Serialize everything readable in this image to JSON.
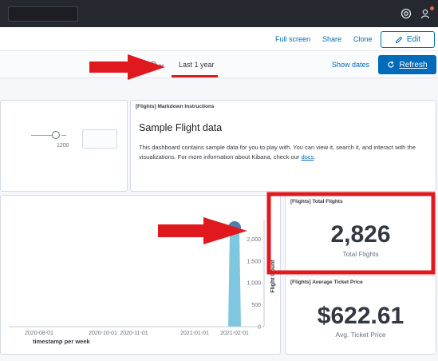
{
  "header": {
    "help_icon": "help-icon",
    "user_icon": "user-menu-icon"
  },
  "actions": {
    "full_screen": "Full screen",
    "share": "Share",
    "clone": "Clone",
    "edit": "Edit",
    "edit_icon": "pencil-icon"
  },
  "query": {
    "time_range": "Last 1 year",
    "show_dates": "Show dates",
    "refresh": "Refresh",
    "refresh_icon": "refresh-icon",
    "calendar_icon": "calendar-icon"
  },
  "controls": {
    "slider_max": "1200"
  },
  "markdown": {
    "title": "[Flights] Markdown Instructions",
    "heading": "Sample Flight data",
    "body": "This dashboard contains sample data for you to play with. You can view it, search it, and interact with the visualizations. For more information about Kibana, check our ",
    "link": "docs",
    "suffix": "."
  },
  "total_flights": {
    "title": "[Flights] Total Flights",
    "value": "2,826",
    "caption": "Total Flights"
  },
  "avg_price": {
    "title": "[Flights] Average Ticket Price",
    "value": "$622.61",
    "caption": "Avg. Ticket Price"
  },
  "chart_data": {
    "type": "area",
    "x": [
      "2020-08-01",
      "2020-10-01",
      "2020-11-01",
      "2021-01-01",
      "2021-02-01"
    ],
    "x_tick_labels": [
      "2020-08-01",
      "2020-10-01",
      "2020-11-01",
      "2021-01-01",
      "2021-02-01"
    ],
    "y_tick_labels": [
      "0",
      "500",
      "1,000",
      "1,500",
      "2,000"
    ],
    "ylim": [
      0,
      2300
    ],
    "xlabel": "timestamp per week",
    "ylabel": "Flight Count",
    "series": [
      {
        "values": [
          0,
          0,
          0,
          0,
          2300
        ]
      }
    ],
    "color": "#54b3d6",
    "grid": false
  },
  "annotations": {
    "arrow_color": "#e0191f",
    "box_color": "#e0191f"
  }
}
